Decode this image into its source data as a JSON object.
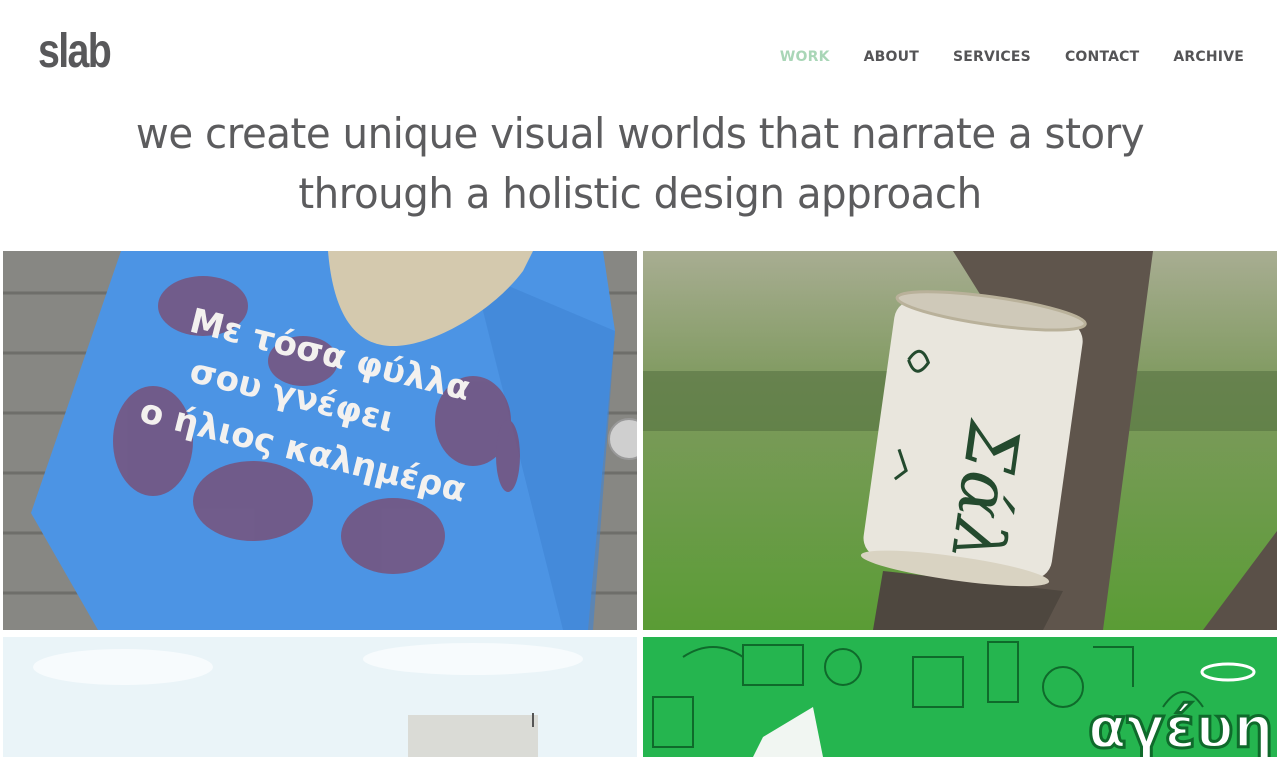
{
  "brand": {
    "logo_text": "slab"
  },
  "nav": {
    "items": [
      {
        "label": "WORK",
        "active": true
      },
      {
        "label": "ABOUT",
        "active": false
      },
      {
        "label": "SERVICES",
        "active": false
      },
      {
        "label": "CONTACT",
        "active": false
      },
      {
        "label": "ARCHIVE",
        "active": false
      }
    ]
  },
  "hero": {
    "line1": "we create unique visual worlds that narrate a story",
    "line2": "through a holistic design approach"
  },
  "projects": {
    "tote": {
      "line1": "Με τόσα φύλλα",
      "line2": "σου γνέφει",
      "line3": "ο ήλιος καλημέρα"
    },
    "can": {
      "label": "Σάλ"
    },
    "green": {
      "logo": "αγέυη"
    }
  },
  "colors": {
    "accent_active_nav": "#a9d6b7",
    "text": "#5b5b5d",
    "tote_blue": "#4d96e6",
    "green_tile": "#25b54f"
  }
}
